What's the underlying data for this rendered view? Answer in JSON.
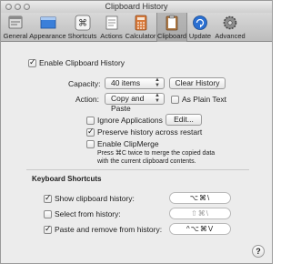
{
  "window": {
    "title": "Clipboard History"
  },
  "toolbar": {
    "items": [
      {
        "label": "General",
        "icon": "general-icon"
      },
      {
        "label": "Appearance",
        "icon": "appearance-icon"
      },
      {
        "label": "Shortcuts",
        "icon": "shortcuts-icon"
      },
      {
        "label": "Actions",
        "icon": "actions-icon"
      },
      {
        "label": "Calculator",
        "icon": "calculator-icon"
      },
      {
        "label": "Clipboard",
        "icon": "clipboard-icon",
        "selected": true
      },
      {
        "label": "Update",
        "icon": "update-icon"
      },
      {
        "label": "Advanced",
        "icon": "advanced-icon"
      }
    ]
  },
  "clipboard": {
    "enable_label": "Enable Clipboard History",
    "enable_checked": true,
    "capacity_label": "Capacity:",
    "capacity_value": "40 items",
    "clear_button": "Clear History",
    "action_label": "Action:",
    "action_value": "Copy and Paste",
    "plain_text_label": "As Plain Text",
    "plain_text_checked": false,
    "ignore_apps_label": "Ignore Applications",
    "ignore_apps_checked": false,
    "edit_button": "Edit...",
    "preserve_label": "Preserve history across restart",
    "preserve_checked": true,
    "clipmerge_label": "Enable ClipMerge",
    "clipmerge_checked": false,
    "clipmerge_hint_line1": "Press ⌘C twice to merge the copied data",
    "clipmerge_hint_line2": "with the current clipboard contents."
  },
  "shortcuts": {
    "section_title": "Keyboard Shortcuts",
    "items": [
      {
        "label": "Show clipboard history:",
        "checked": true,
        "keys": "⌥⌘\\",
        "placeholder": false
      },
      {
        "label": "Select from history:",
        "checked": false,
        "keys": "⇧⌘\\",
        "placeholder": true
      },
      {
        "label": "Paste and remove from history:",
        "checked": true,
        "keys": "^⌥⌘V",
        "placeholder": false
      }
    ]
  },
  "help": {
    "label": "?"
  }
}
